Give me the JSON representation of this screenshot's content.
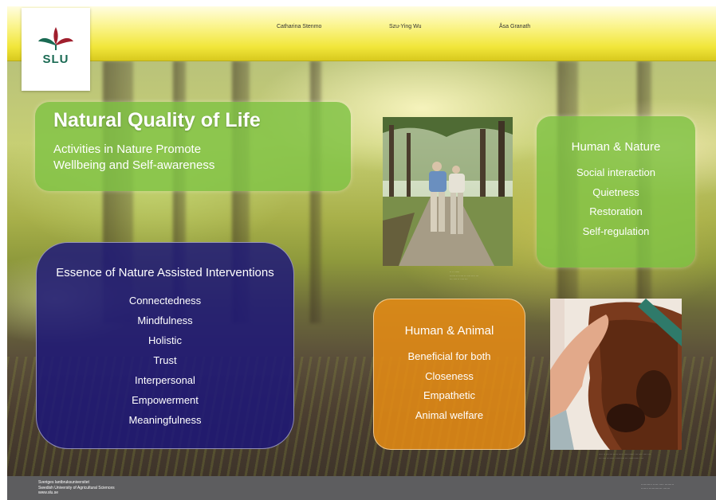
{
  "header": {
    "authors": [
      "Catharina Stenmo",
      "Szu-Ying Wu",
      "Åsa Granath"
    ],
    "logo_text": "SLU"
  },
  "title_box": {
    "title": "Natural Quality of Life",
    "subtitle_line1": "Activities in Nature Promote",
    "subtitle_line2": "Wellbeing and Self-awareness"
  },
  "human_nature": {
    "heading": "Human & Nature",
    "items": [
      "Social interaction",
      "Quietness",
      "Restoration",
      "Self-regulation"
    ]
  },
  "essence": {
    "heading": "Essence of Nature Assisted Interventions",
    "items": [
      "Connectedness",
      "Mindfulness",
      "Holistic",
      "Trust",
      "Interpersonal",
      "Empowerment",
      "Meaningfulness"
    ]
  },
  "human_animal": {
    "heading": "Human & Animal",
    "items": [
      "Beneficial for both",
      "Closeness",
      "Empathetic",
      "Animal welfare"
    ]
  },
  "footer": {
    "line1": "Sveriges lantbruksuniversitet",
    "line2": "Swedish University of Agricultural Sciences",
    "line3": "www.slu.se"
  },
  "colors": {
    "header_yellow": "#f1e63a",
    "green_box": "#80c346",
    "navy_box": "#1c167a",
    "orange_box": "#e68c14",
    "footer_gray": "#5d5d5f",
    "slu_green": "#1a6a53",
    "slu_red": "#a01f2d"
  },
  "icons": [
    "slu-leaf-logo-icon"
  ]
}
